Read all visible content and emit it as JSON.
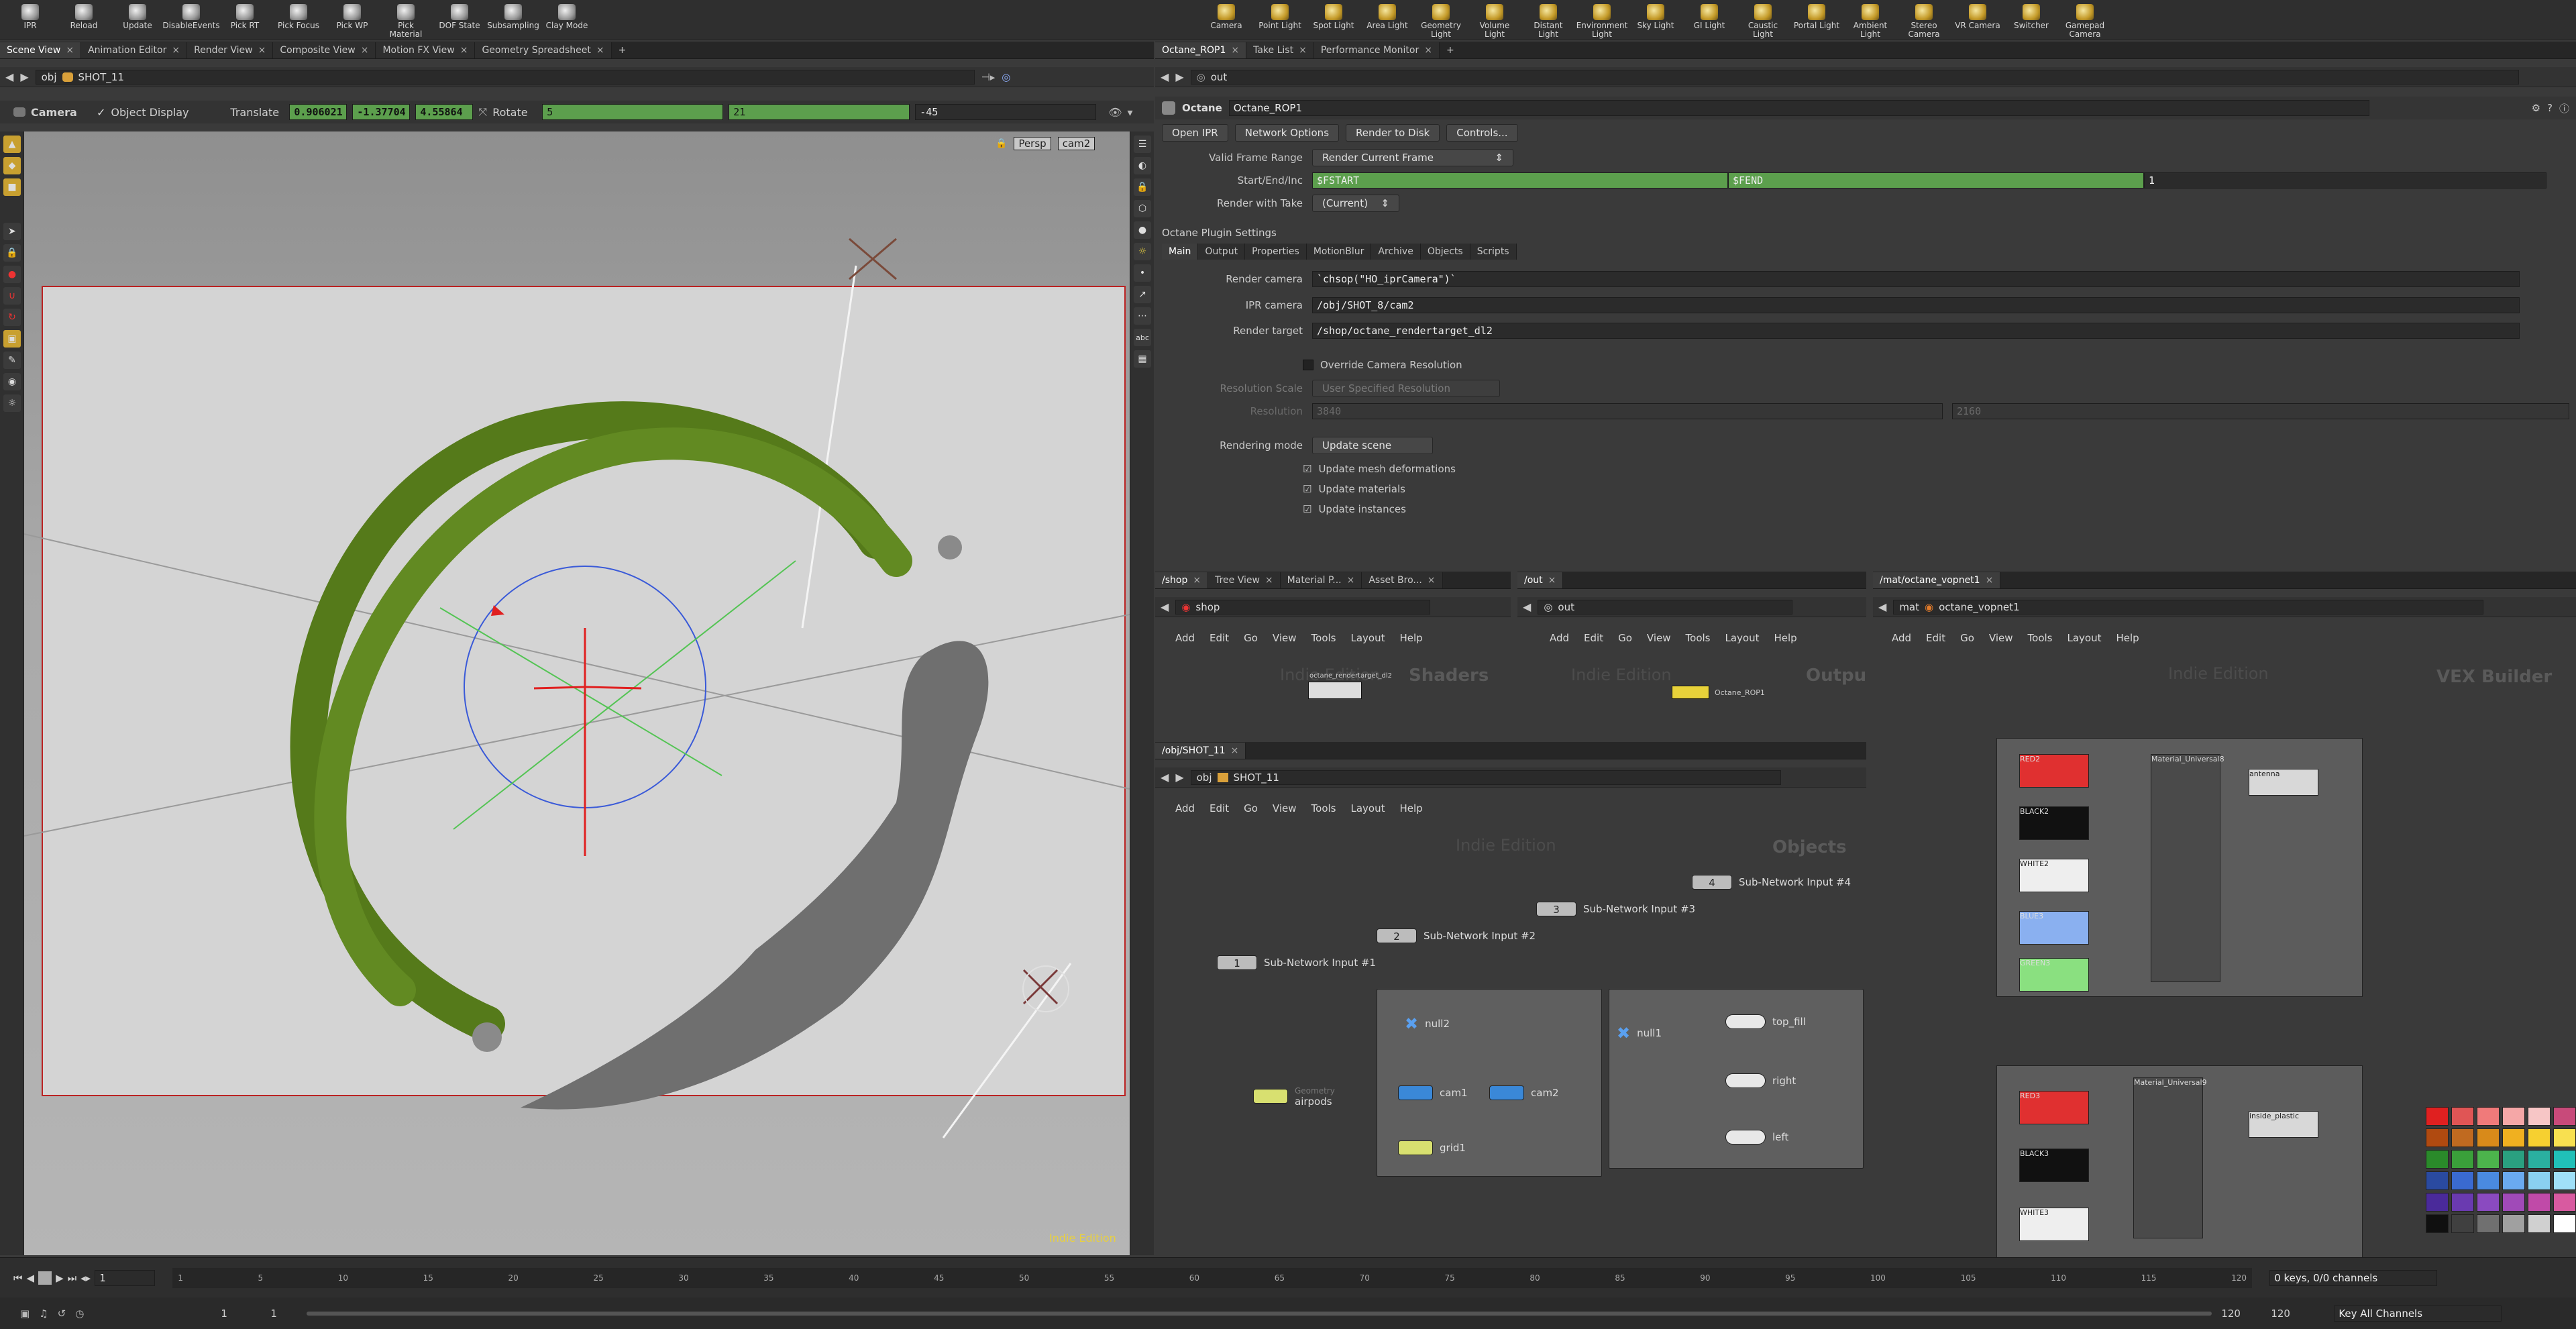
{
  "shelf_left": [
    {
      "label": "IPR",
      "icon": "ipr-icon"
    },
    {
      "label": "Reload",
      "icon": "reload-icon"
    },
    {
      "label": "Update",
      "icon": "update-icon"
    },
    {
      "label": "DisableEvents",
      "icon": "disable-events-icon"
    },
    {
      "label": "Pick RT",
      "icon": "pick-rt-icon"
    },
    {
      "label": "Pick Focus",
      "icon": "pick-focus-icon"
    },
    {
      "label": "Pick WP",
      "icon": "pick-wp-icon"
    },
    {
      "label": "Pick Material",
      "icon": "pick-material-icon"
    },
    {
      "label": "DOF State",
      "icon": "dof-state-icon"
    },
    {
      "label": "Subsampling",
      "icon": "subsampling-icon"
    },
    {
      "label": "Clay Mode",
      "icon": "clay-mode-icon"
    }
  ],
  "shelf_right": [
    {
      "label": "Camera"
    },
    {
      "label": "Point Light"
    },
    {
      "label": "Spot Light"
    },
    {
      "label": "Area Light"
    },
    {
      "label": "Geometry\nLight"
    },
    {
      "label": "Volume Light"
    },
    {
      "label": "Distant Light"
    },
    {
      "label": "Environment\nLight"
    },
    {
      "label": "Sky Light"
    },
    {
      "label": "GI Light"
    },
    {
      "label": "Caustic Light"
    },
    {
      "label": "Portal Light"
    },
    {
      "label": "Ambient Light"
    },
    {
      "label": "Stereo\nCamera"
    },
    {
      "label": "VR Camera"
    },
    {
      "label": "Switcher"
    },
    {
      "label": "Gamepad\nCamera"
    }
  ],
  "left_tabs": [
    "Scene View",
    "Animation Editor",
    "Render View",
    "Composite View",
    "Motion FX View",
    "Geometry Spreadsheet"
  ],
  "viewer_path": {
    "root": "obj",
    "node": "SHOT_11"
  },
  "camera_bar": {
    "mode": "Camera",
    "object_display": "Object Display",
    "translate_label": "Translate",
    "tx": "0.906021",
    "ty": "-1.37704",
    "tz": "4.55864",
    "rotate_label": "Rotate",
    "rx": "5",
    "ry": "21",
    "rz": "-45"
  },
  "viewport": {
    "persp": "Persp",
    "cam": "cam2",
    "watermark": "Indie Edition"
  },
  "right_tabs": [
    "Octane_ROP1",
    "Take List",
    "Performance Monitor"
  ],
  "rop_path": "out",
  "rop": {
    "type": "Octane",
    "name": "Octane_ROP1",
    "buttons": [
      "Open IPR",
      "Network Options",
      "Render to Disk",
      "Controls..."
    ],
    "valid_frame_range_label": "Valid Frame Range",
    "valid_frame_range": "Render Current Frame",
    "start_end_label": "Start/End/Inc",
    "fstart": "$FSTART",
    "fend": "$FEND",
    "inc": "1",
    "take_label": "Render with Take",
    "take": "(Current)",
    "plugin_settings": "Octane Plugin Settings",
    "plugin_tabs": [
      "Main",
      "Output",
      "Properties",
      "MotionBlur",
      "Archive",
      "Objects",
      "Scripts"
    ],
    "render_camera_label": "Render camera",
    "render_camera": "`chsop(\"HO_iprCamera\")`",
    "ipr_camera_label": "IPR camera",
    "ipr_camera": "/obj/SHOT_8/cam2",
    "render_target_label": "Render target",
    "render_target": "/shop/octane_rendertarget_dl2",
    "override_res": "Override Camera Resolution",
    "res_scale_label": "Resolution Scale",
    "res_scale": "User Specified Resolution",
    "res_label": "Resolution",
    "res_x": "3840",
    "res_y": "2160",
    "rendering_mode_label": "Rendering mode",
    "rendering_mode": "Update scene",
    "update_mesh": "Update mesh deformations",
    "update_materials": "Update materials",
    "update_instances": "Update instances"
  },
  "shop_tabs": [
    "/shop",
    "Tree View",
    "Material P...",
    "Asset Bro..."
  ],
  "out_tabs": [
    "/out"
  ],
  "vex_tabs": [
    "/mat/octane_vopnet1"
  ],
  "menus": [
    "Add",
    "Edit",
    "Go",
    "View",
    "Tools",
    "Layout",
    "Help"
  ],
  "shop_pane": {
    "path": "shop",
    "watermark": "Indie Edition",
    "title": "Shaders",
    "node": "octane_rendertarget_dl2"
  },
  "out_pane": {
    "path": "out",
    "watermark": "Indie Edition",
    "title": "Outputs",
    "node": "Octane_ROP1"
  },
  "obj_tabs": [
    "/obj/SHOT_11"
  ],
  "obj_pane": {
    "root": "obj",
    "path": "SHOT_11",
    "watermark": "Indie Edition",
    "title": "Objects",
    "inputs": [
      "Sub-Network Input #1",
      "Sub-Network Input #2",
      "Sub-Network Input #3",
      "Sub-Network Input #4"
    ],
    "input_nums": [
      "1",
      "2",
      "3",
      "4"
    ],
    "nodes": {
      "null2": "null2",
      "cam1": "cam1",
      "cam2": "cam2",
      "grid1": "grid1",
      "geometry": "Geometry",
      "airpods": "airpods",
      "null1": "null1",
      "top_fill": "top_fill",
      "right": "right",
      "left": "left"
    }
  },
  "vex_pane": {
    "root": "mat",
    "path": "octane_vopnet1",
    "watermark": "Indie Edition",
    "title": "VEX Builder",
    "nodes": [
      "RED2",
      "BLACK2",
      "WHITE2",
      "BLUE3",
      "GREEN3",
      "Material_Universal8",
      "antenna",
      "RED3",
      "BLACK3",
      "WHITE3",
      "Material_Universal9",
      "inside_plastic"
    ]
  },
  "timeline": {
    "frame": "1",
    "start": "1",
    "start2": "1",
    "end": "120",
    "end2": "120",
    "keys": "0 keys, 0/0 channels",
    "key_all": "Key All Channels",
    "ticks": [
      "1",
      "5",
      "10",
      "15",
      "20",
      "25",
      "30",
      "35",
      "40",
      "45",
      "50",
      "55",
      "60",
      "65",
      "70",
      "75",
      "80",
      "85",
      "90",
      "95",
      "100",
      "105",
      "110",
      "115",
      "120"
    ]
  },
  "palette": [
    "#e02020",
    "#e05555",
    "#f07a7a",
    "#f5a7a7",
    "#f7c6c6",
    "#c84a7a",
    "#b04a10",
    "#c06a20",
    "#d88a1a",
    "#f0b020",
    "#f6d030",
    "#f8e050",
    "#2a8a2a",
    "#3aa03a",
    "#4cb44c",
    "#2aa080",
    "#2ab0a0",
    "#20c0b8",
    "#2a4aa0",
    "#3a6ad0",
    "#4a8ae0",
    "#6aaaf0",
    "#8ad0f0",
    "#a0e0f8",
    "#4a2a9a",
    "#6a3ab0",
    "#8a4ac0",
    "#a04ab8",
    "#c04aa8",
    "#d85aa0",
    "#101010",
    "#404040",
    "#707070",
    "#a0a0a0",
    "#d0d0d0",
    "#ffffff"
  ]
}
